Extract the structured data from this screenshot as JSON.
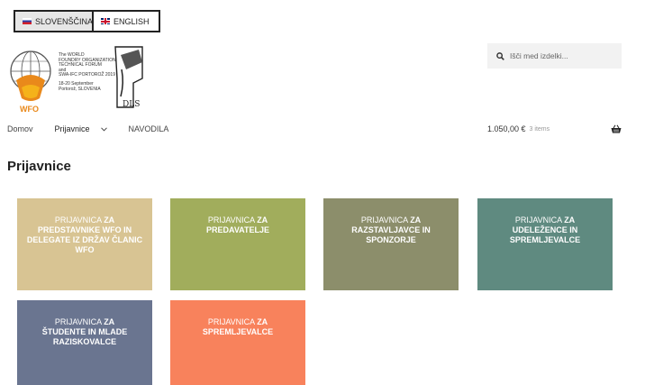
{
  "languages": [
    {
      "label": "SLOVENŠČINA",
      "active": true
    },
    {
      "label": "ENGLISH",
      "active": false
    }
  ],
  "logo": {
    "lines": [
      "The WORLD",
      "FOUNDRY ORGANIZATION",
      "TECHNICAL FORUM",
      "and",
      "SWA-IFC PORTOROŽ 2019"
    ],
    "lines2": [
      "18-20 September",
      "Portorož, SLOVENIA"
    ],
    "wfo_text": "WFO",
    "dls_text": "DLS"
  },
  "search": {
    "placeholder": "Išči med izdelki..."
  },
  "nav": {
    "items": [
      "Domov",
      "Prijavnice",
      "NAVODILA"
    ]
  },
  "cart": {
    "total": "1.050,00 €",
    "count": "3 items"
  },
  "page": {
    "title": "Prijavnice"
  },
  "tiles": [
    {
      "prefix": "Prijavnica",
      "bold_za": "za",
      "rest": "predstavnike WFO in delegate iz držav članic WFO",
      "color": "#d8c493"
    },
    {
      "prefix": "Prijavnica",
      "bold_za": "za",
      "rest": "predavatelje",
      "color": "#a1ad5c"
    },
    {
      "prefix": "Prijavnica",
      "bold_za": "za",
      "rest": "razstavljavce in sponzorje",
      "color": "#8c8e6b"
    },
    {
      "prefix": "Prijavnica",
      "bold_za": "za",
      "rest": "udeležence in spremljevalce",
      "color": "#5f8a80"
    },
    {
      "prefix": "Prijavnica",
      "bold_za": "za",
      "rest": "študente in mlade raziskovalce",
      "color": "#6a7590"
    },
    {
      "prefix": "Prijavnica",
      "bold_za": "za",
      "rest": "spremljevalce",
      "color": "#f8825c"
    }
  ]
}
